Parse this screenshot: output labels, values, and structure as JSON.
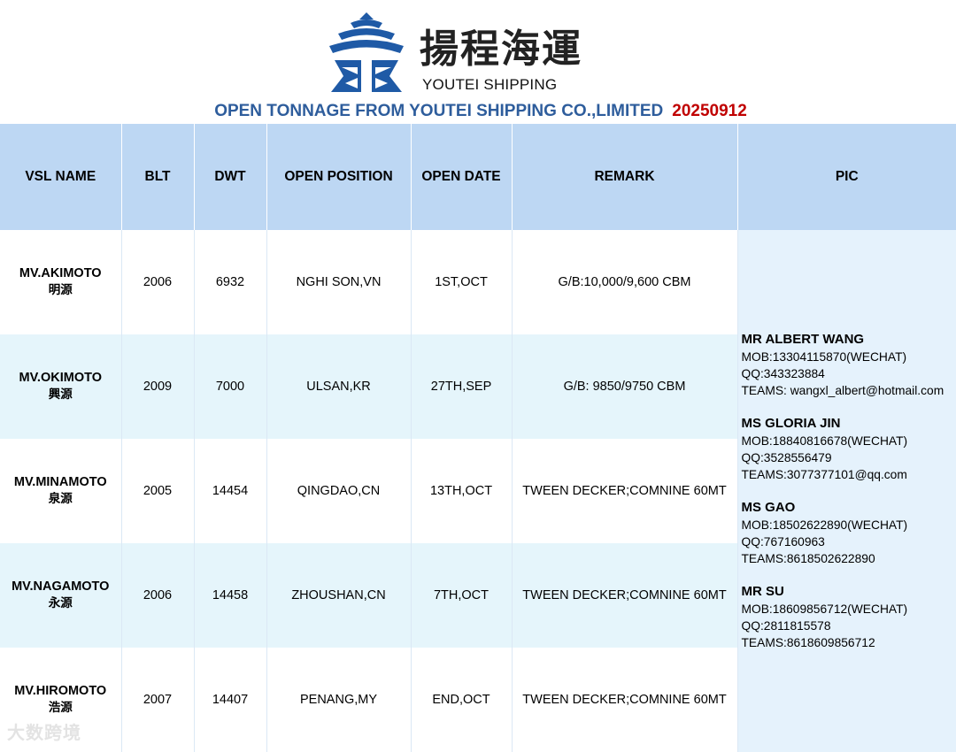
{
  "header": {
    "logo_cn": "揚程海運",
    "logo_en": "YOUTEI SHIPPING",
    "title": "OPEN TONNAGE FROM YOUTEI SHIPPING CO.,LIMITED",
    "date": "20250912",
    "colors": {
      "brand_blue": "#1f5aa6",
      "title_blue": "#2e5d9c",
      "date_red": "#c00000",
      "header_bg": "#bdd7f3"
    }
  },
  "table": {
    "columns": [
      "VSL  NAME",
      "BLT",
      "DWT",
      "OPEN POSITION",
      "OPEN DATE",
      "REMARK",
      "PIC"
    ],
    "rows": [
      {
        "vsl": "MV.AKIMOTO",
        "vsl_cn": "明源",
        "blt": "2006",
        "dwt": "6932",
        "position": "NGHI SON,VN",
        "date": "1ST,OCT",
        "remark": "G/B:10,000/9,600 CBM"
      },
      {
        "vsl": "MV.OKIMOTO",
        "vsl_cn": "興源",
        "blt": "2009",
        "dwt": "7000",
        "position": "ULSAN,KR",
        "date": "27TH,SEP",
        "remark": "G/B: 9850/9750 CBM"
      },
      {
        "vsl": "MV.MINAMOTO",
        "vsl_cn": "泉源",
        "blt": "2005",
        "dwt": "14454",
        "position": "QINGDAO,CN",
        "date": "13TH,OCT",
        "remark": "TWEEN DECKER;COMNINE 60MT"
      },
      {
        "vsl": "MV.NAGAMOTO",
        "vsl_cn": "永源",
        "blt": "2006",
        "dwt": "14458",
        "position": "ZHOUSHAN,CN",
        "date": "7TH,OCT",
        "remark": "TWEEN DECKER;COMNINE 60MT"
      },
      {
        "vsl": "MV.HIROMOTO",
        "vsl_cn": "浩源",
        "blt": "2007",
        "dwt": "14407",
        "position": "PENANG,MY",
        "date": "END,OCT",
        "remark": "TWEEN DECKER;COMNINE 60MT"
      }
    ]
  },
  "pic": {
    "contacts": [
      {
        "name": "MR ALBERT WANG",
        "lines": [
          "MOB:13304115870(WECHAT)",
          "QQ:343323884",
          "TEAMS: wangxl_albert@hotmail.com"
        ]
      },
      {
        "name": "MS GLORIA JIN",
        "lines": [
          "MOB:18840816678(WECHAT)",
          "QQ:3528556479",
          "TEAMS:3077377101@qq.com"
        ]
      },
      {
        "name": "MS GAO",
        "lines": [
          "MOB:18502622890(WECHAT)",
          "QQ:767160963",
          "TEAMS:8618502622890"
        ]
      },
      {
        "name": "MR SU",
        "lines": [
          "MOB:18609856712(WECHAT)",
          "QQ:2811815578",
          "TEAMS:8618609856712"
        ]
      }
    ]
  },
  "watermark": "大数跨境"
}
